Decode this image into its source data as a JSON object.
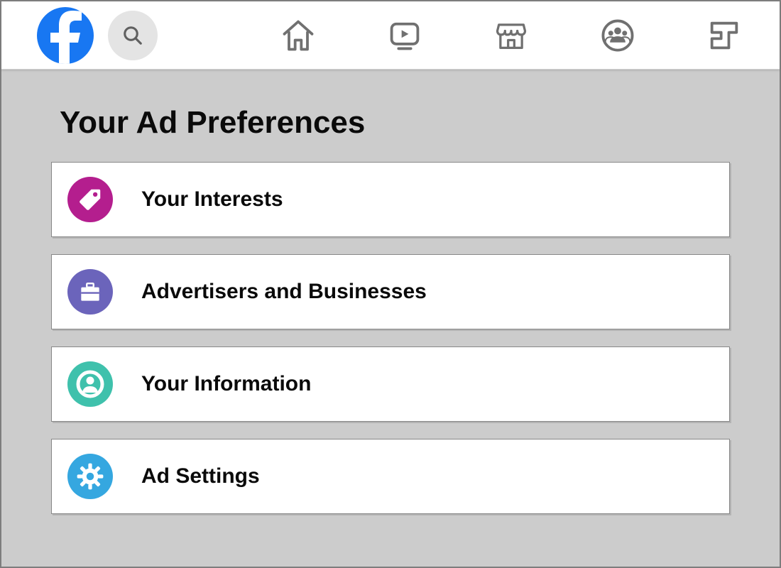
{
  "brand": {
    "logo_color": "#1877F2",
    "logo_letter": "f"
  },
  "nav": {
    "search": "search-icon",
    "items": [
      {
        "name": "home-icon"
      },
      {
        "name": "watch-icon"
      },
      {
        "name": "marketplace-icon"
      },
      {
        "name": "groups-icon"
      },
      {
        "name": "gaming-icon"
      }
    ]
  },
  "page": {
    "title": "Your Ad Preferences"
  },
  "cards": [
    {
      "label": "Your Interests",
      "icon": "tag-icon",
      "color": "#b41e8e"
    },
    {
      "label": "Advertisers and Businesses",
      "icon": "briefcase-icon",
      "color": "#6b64bb"
    },
    {
      "label": "Your Information",
      "icon": "person-circle-icon",
      "color": "#3fc1ac"
    },
    {
      "label": "Ad Settings",
      "icon": "gear-icon",
      "color": "#35a7e0"
    }
  ]
}
